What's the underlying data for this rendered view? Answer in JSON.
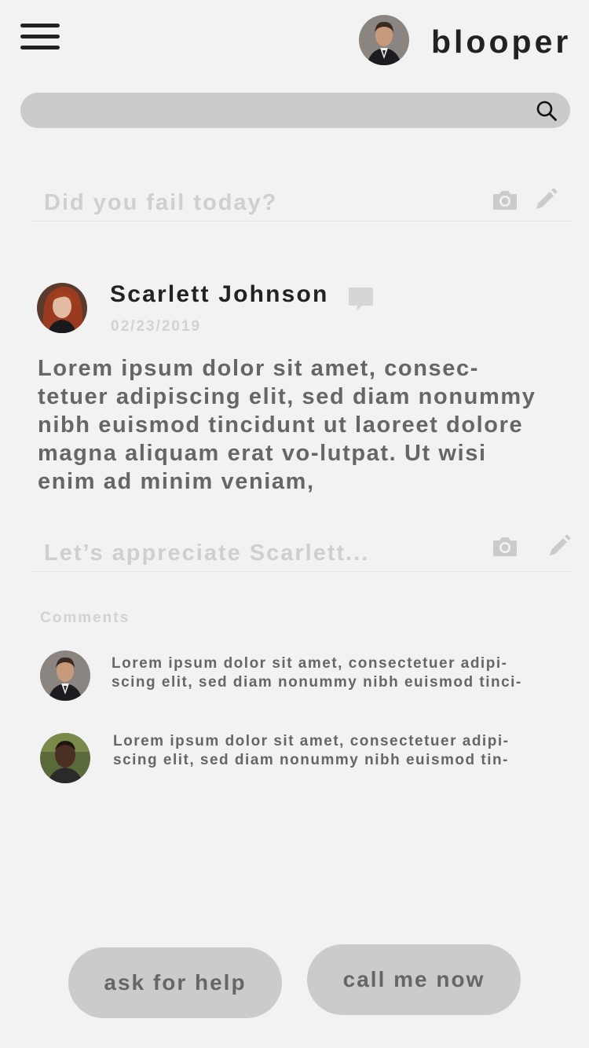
{
  "header": {
    "brand": "blooper",
    "menu_icon": "hamburger-menu-icon",
    "profile_avatar": "user-avatar"
  },
  "search": {
    "value": "",
    "placeholder": "",
    "icon": "search-icon"
  },
  "composer": {
    "placeholder": "Did you fail today?",
    "icons": [
      "camera-icon",
      "pencil-icon"
    ]
  },
  "post": {
    "author": "Scarlett Johnson",
    "date": "02/23/2019",
    "body": "Lorem ipsum dolor sit amet, consec-tetuer adipiscing elit, sed diam nonummy nibh euismod tincidunt ut laoreet dolore magna aliquam erat vo-lutpat. Ut wisi enim ad minim veniam,",
    "reply_placeholder": "Let’s appreciate Scarlett...",
    "chat_icon": "chat-bubble-icon"
  },
  "comments": {
    "label": "Comments",
    "items": [
      {
        "text": "Lorem ipsum dolor sit amet, consectetuer adipi-scing elit, sed diam nonummy nibh euismod tinci-"
      },
      {
        "text": "Lorem ipsum dolor sit amet, consectetuer adipi-scing elit, sed diam nonummy nibh euismod tin-"
      }
    ]
  },
  "actions": {
    "help_label": "ask for help",
    "call_label": "call me now"
  },
  "colors": {
    "background": "#f2f2f2",
    "pill": "#cbcbcb",
    "heading": "#222222",
    "body_text": "#666666",
    "muted": "#d2d2d2"
  }
}
